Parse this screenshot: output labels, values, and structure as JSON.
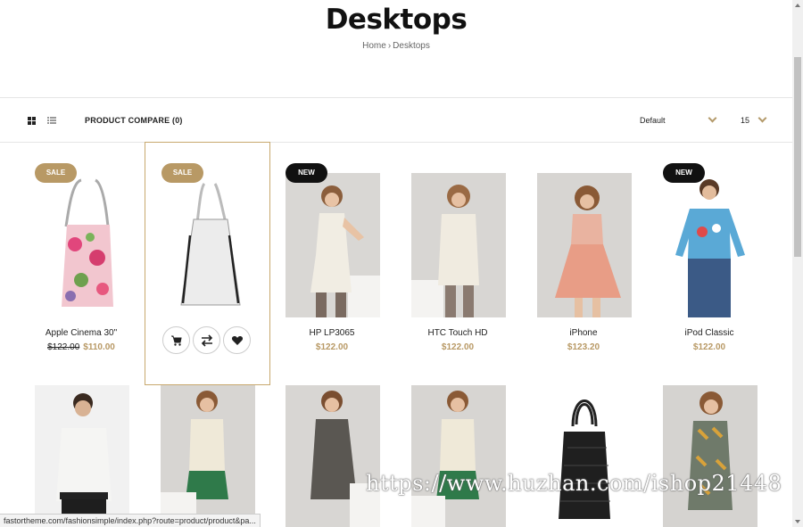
{
  "page": {
    "title": "Desktops",
    "breadcrumb": [
      "Home",
      "Desktops"
    ]
  },
  "toolbar": {
    "compare_label": "PRODUCT COMPARE (0)",
    "sort_value": "Default",
    "limit_value": "15"
  },
  "products_row1": [
    {
      "name": "Apple Cinema 30\"",
      "old_price": "$122.00",
      "price": "$110.00",
      "badge": "SALE"
    },
    {
      "name": "",
      "price": "",
      "badge": "SALE",
      "hovered": true
    },
    {
      "name": "HP LP3065",
      "price": "$122.00",
      "badge": "NEW"
    },
    {
      "name": "HTC Touch HD",
      "price": "$122.00",
      "badge": ""
    },
    {
      "name": "iPhone",
      "price": "$123.20",
      "badge": ""
    },
    {
      "name": "iPod Classic",
      "price": "$122.00",
      "badge": "NEW"
    }
  ],
  "hover_actions": [
    "cart-icon",
    "compare-icon",
    "heart-icon"
  ],
  "status_url": "fastortheme.com/fashionsimple/index.php?route=product/product&pa...",
  "watermark": "https://www.huzhan.com/ishop21448",
  "colors": {
    "accent": "#b89965",
    "new_badge": "#111111"
  }
}
